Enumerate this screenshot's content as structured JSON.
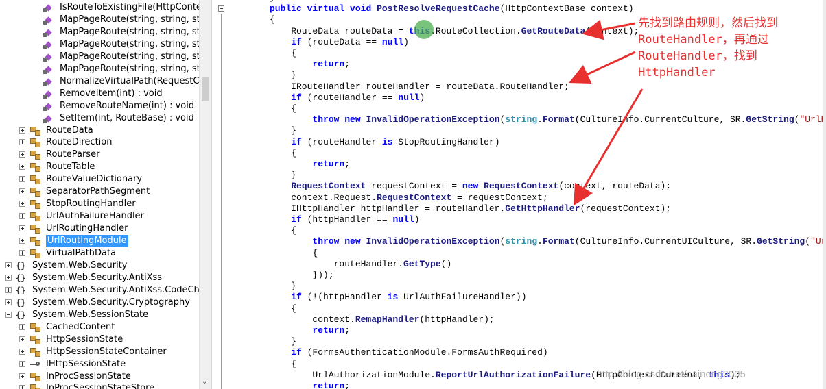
{
  "tree": {
    "items": [
      {
        "label": "IsRouteToExistingFile(HttpConte",
        "icon": "method-icon"
      },
      {
        "label": "MapPageRoute(string, string, str",
        "icon": "method-icon"
      },
      {
        "label": "MapPageRoute(string, string, str",
        "icon": "method-icon"
      },
      {
        "label": "MapPageRoute(string, string, str",
        "icon": "method-icon"
      },
      {
        "label": "MapPageRoute(string, string, str",
        "icon": "method-icon"
      },
      {
        "label": "MapPageRoute(string, string, str",
        "icon": "method-icon"
      },
      {
        "label": "NormalizeVirtualPath(RequestCo",
        "icon": "method-icon"
      },
      {
        "label": "RemoveItem(int) : void",
        "icon": "method-icon"
      },
      {
        "label": "RemoveRouteName(int) : void",
        "icon": "method-icon"
      },
      {
        "label": "SetItem(int, RouteBase) : void",
        "icon": "method-icon"
      },
      {
        "label": "RouteData",
        "icon": "class-icon"
      },
      {
        "label": "RouteDirection",
        "icon": "enum-icon"
      },
      {
        "label": "RouteParser",
        "icon": "class-icon"
      },
      {
        "label": "RouteTable",
        "icon": "class-icon"
      },
      {
        "label": "RouteValueDictionary",
        "icon": "class-icon"
      },
      {
        "label": "SeparatorPathSegment",
        "icon": "class-icon"
      },
      {
        "label": "StopRoutingHandler",
        "icon": "class-icon"
      },
      {
        "label": "UrlAuthFailureHandler",
        "icon": "class-icon"
      },
      {
        "label": "UrlRoutingHandler",
        "icon": "class-icon"
      },
      {
        "label": "UrlRoutingModule",
        "icon": "class-icon",
        "selected": true
      },
      {
        "label": "VirtualPathData",
        "icon": "class-icon"
      },
      {
        "label": "System.Web.Security",
        "icon": "namespace-icon"
      },
      {
        "label": "System.Web.Security.AntiXss",
        "icon": "namespace-icon"
      },
      {
        "label": "System.Web.Security.AntiXss.CodeChar",
        "icon": "namespace-icon"
      },
      {
        "label": "System.Web.Security.Cryptography",
        "icon": "namespace-icon"
      },
      {
        "label": "System.Web.SessionState",
        "icon": "namespace-icon"
      },
      {
        "label": "CachedContent",
        "icon": "class-icon"
      },
      {
        "label": "HttpSessionState",
        "icon": "class-icon"
      },
      {
        "label": "HttpSessionStateContainer",
        "icon": "class-icon"
      },
      {
        "label": "IHttpSessionState",
        "icon": "interface-icon"
      },
      {
        "label": "InProcSessionState",
        "icon": "class-icon"
      },
      {
        "label": "InProcSessionStateStore",
        "icon": "class-icon"
      }
    ]
  },
  "code": {
    "lines": [
      "}",
      "public virtual void PostResolveRequestCache(HttpContextBase context)",
      "{",
      "    RouteData routeData = this.RouteCollection.GetRouteData(context);",
      "    if (routeData == null)",
      "    {",
      "        return;",
      "    }",
      "    IRouteHandler routeHandler = routeData.RouteHandler;",
      "    if (routeHandler == null)",
      "    {",
      "        throw new InvalidOperationException(string.Format(CultureInfo.CurrentCulture, SR.GetString(\"UrlRou",
      "    }",
      "    if (routeHandler is StopRoutingHandler)",
      "    {",
      "        return;",
      "    }",
      "    RequestContext requestContext = new RequestContext(context, routeData);",
      "    context.Request.RequestContext = requestContext;",
      "    IHttpHandler httpHandler = routeHandler.GetHttpHandler(requestContext);",
      "    if (httpHandler == null)",
      "    {",
      "        throw new InvalidOperationException(string.Format(CultureInfo.CurrentUICulture, SR.GetString(\"UrlR",
      "        {",
      "            routeHandler.GetType()",
      "        }));",
      "    }",
      "    if (!(httpHandler is UrlAuthFailureHandler))",
      "    {",
      "        context.RemapHandler(httpHandler);",
      "        return;",
      "    }",
      "    if (FormsAuthenticationModule.FormsAuthRequired)",
      "    {",
      "        UrlAuthorizationModule.ReportUrlAuthorizationFailure(HttpContext.Current, this);",
      "        return;"
    ]
  },
  "annotation": {
    "line1": "先找到路由规则，然后找到",
    "line2": "RouteHandler，再通过",
    "line3": "RouteHandler，找到",
    "line4": "HttpHandler",
    "color": "#e8302f"
  },
  "watermark": "http://blog.csdn.net/cainong2005",
  "colors": {
    "keyword": "#0000ff",
    "type": "#2b91af",
    "string": "#a31515",
    "selection": "#3399ff"
  }
}
